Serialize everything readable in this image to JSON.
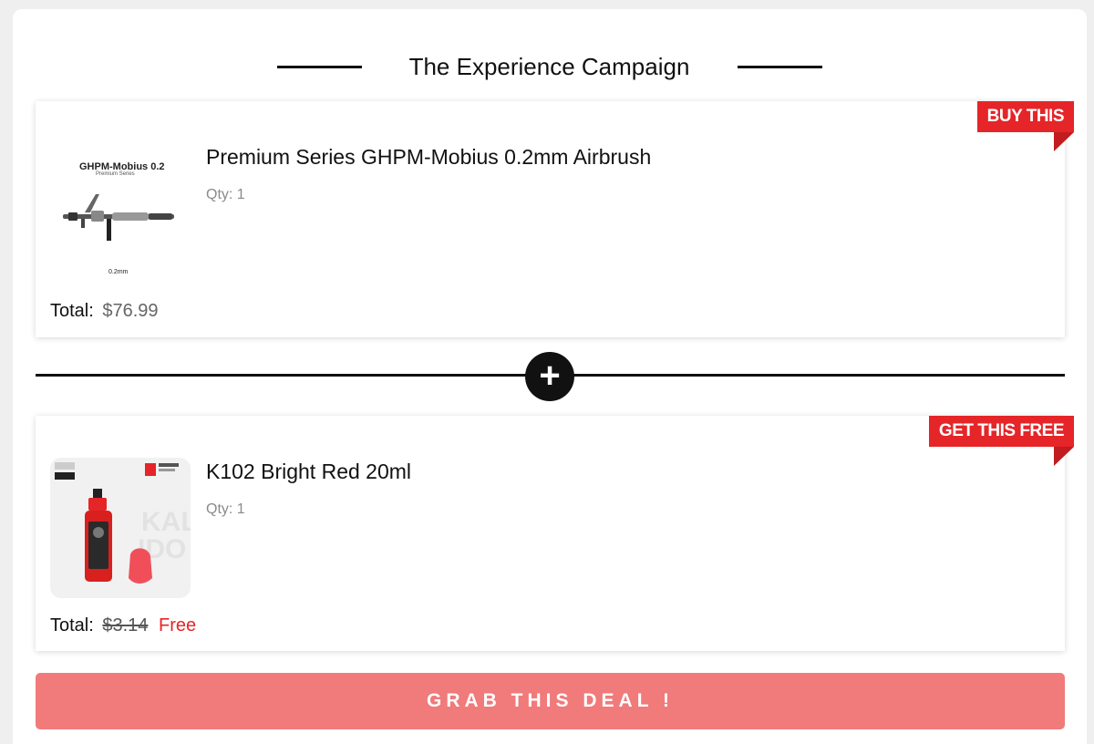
{
  "campaign": {
    "title": "The Experience Campaign"
  },
  "offer_main": {
    "ribbon": "BUY THIS",
    "name": "Premium Series GHPM-Mobius 0.2mm Airbrush",
    "qty": "Qty: 1",
    "total_label": "Total:",
    "total_price": "$76.99",
    "thumb_title": "GHPM-Mobius 0.2",
    "thumb_subtitle": "Premium Series",
    "thumb_caption": "0.2mm"
  },
  "offer_free": {
    "ribbon": "GET THIS FREE",
    "name": "K102 Bright Red 20ml",
    "qty": "Qty: 1",
    "total_label": "Total:",
    "original_price": "$3.14",
    "free_label": "Free"
  },
  "plus_symbol": "+",
  "cta": {
    "label": "GRAB THIS DEAL !"
  },
  "colors": {
    "accent_red": "#e52528",
    "cta_bg": "#f17a7a"
  }
}
